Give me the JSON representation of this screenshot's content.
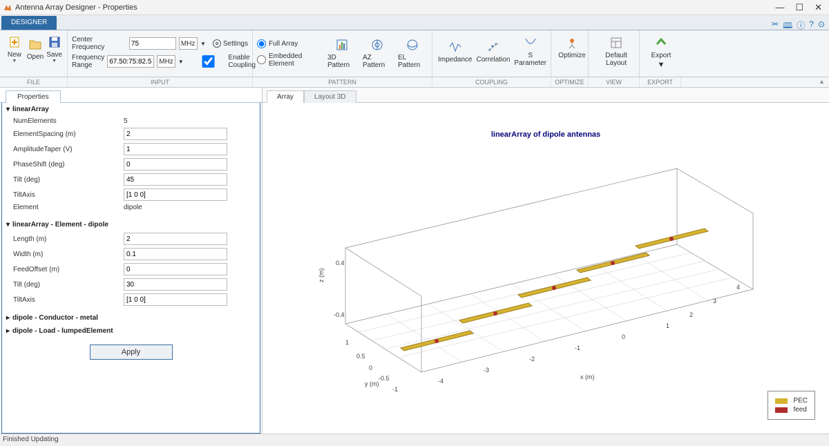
{
  "window": {
    "title": "Antenna Array Designer - Properties"
  },
  "ribbon_tab": "DESIGNER",
  "file_group": {
    "new": "New",
    "open": "Open",
    "save": "Save",
    "label": "FILE"
  },
  "input_group": {
    "center_freq_label": "Center Frequency",
    "center_freq_value": "75",
    "freq_range_label": "Frequency Range",
    "freq_range_value": "67.50:75:82.5",
    "unit": "MHz",
    "settings": "Settings",
    "enable_coupling": "Enable Coupling",
    "label": "INPUT"
  },
  "pattern_group": {
    "full_array": "Full Array",
    "embedded_element": "Embedded Element",
    "pattern3d": "3D Pattern",
    "az": "AZ Pattern",
    "el": "EL Pattern",
    "label": "PATTERN"
  },
  "coupling_group": {
    "impedance": "Impedance",
    "correlation": "Correlation",
    "sparam": "S Parameter",
    "label": "COUPLING"
  },
  "optimize_group": {
    "optimize": "Optimize",
    "label": "OPTIMIZE"
  },
  "view_group": {
    "default_layout": "Default Layout",
    "label": "VIEW"
  },
  "export_group": {
    "export": "Export",
    "label": "EXPORT"
  },
  "properties_tab": "Properties",
  "props": {
    "section1": "linearArray",
    "numElements_label": "NumElements",
    "numElements_value": "5",
    "elementSpacing_label": "ElementSpacing (m)",
    "elementSpacing_value": "2",
    "amplitudeTaper_label": "AmplitudeTaper (V)",
    "amplitudeTaper_value": "1",
    "phaseShift_label": "PhaseShift (deg)",
    "phaseShift_value": "0",
    "tilt_label": "Tilt (deg)",
    "tilt_value": "45",
    "tiltAxis_label": "TiltAxis",
    "tiltAxis_value": "[1 0 0]",
    "element_label": "Element",
    "element_value": "dipole",
    "section2": "linearArray - Element - dipole",
    "length_label": "Length (m)",
    "length_value": "2",
    "width_label": "Width (m)",
    "width_value": "0.1",
    "feedOffset_label": "FeedOffset (m)",
    "feedOffset_value": "0",
    "tilt2_label": "Tilt (deg)",
    "tilt2_value": "30",
    "tiltAxis2_label": "TiltAxis",
    "tiltAxis2_value": "[1 0 0]",
    "section3": "dipole - Conductor - metal",
    "section4": "dipole - Load - lumpedElement",
    "apply": "Apply"
  },
  "doctabs": {
    "array": "Array",
    "layout3d": "Layout 3D"
  },
  "viz": {
    "title": "linearArray of dipole antennas",
    "zlabel": "z (m)",
    "ylabel": "y (m)",
    "xlabel": "x (m)",
    "legend_pec": "PEC",
    "legend_feed": "feed"
  },
  "status": "Finished Updating",
  "chart_data": {
    "type": "3d-antenna-array",
    "num_elements": 5,
    "x_ticks": [
      -4,
      -3,
      -2,
      -1,
      0,
      1,
      2,
      3,
      4
    ],
    "y_ticks": [
      -1,
      -0.5,
      0,
      0.5,
      1
    ],
    "z_ticks": [
      -0.4,
      0.4
    ],
    "colors": {
      "pec": "#d6b331",
      "feed": "#b12d2d"
    }
  }
}
